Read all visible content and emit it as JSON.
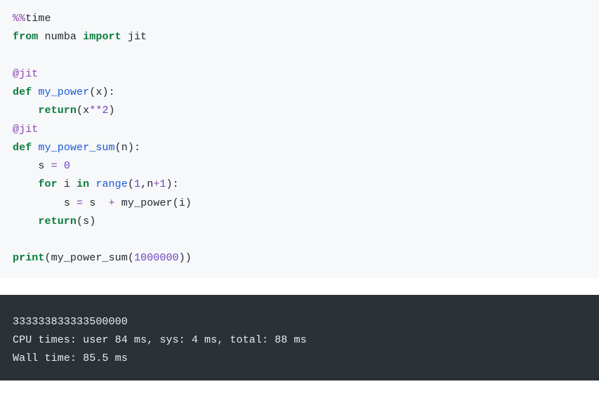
{
  "code": {
    "pct": "%%",
    "magic": "time",
    "from": "from",
    "numba": "numba",
    "import": "import",
    "jit": "jit",
    "at": "@",
    "dec_jit": "jit",
    "def": "def",
    "fn1": "my_power",
    "lp": "(",
    "x": "x",
    "rp": ")",
    "colon": ":",
    "return": "return",
    "star2": "**",
    "two": "2",
    "fn2": "my_power_sum",
    "n": "n",
    "s": "s",
    "eq": " = ",
    "zero": "0",
    "for": "for",
    "i": "i",
    "in": "in",
    "range": "range",
    "one": "1",
    "comma": ",",
    "plus": "+",
    "plus_sp": " + ",
    "print": "print",
    "million": "1000000"
  },
  "output": {
    "line1": "333333833333500000",
    "line2": "CPU times: user 84 ms, sys: 4 ms, total: 88 ms",
    "line3": "Wall time: 85.5 ms"
  }
}
